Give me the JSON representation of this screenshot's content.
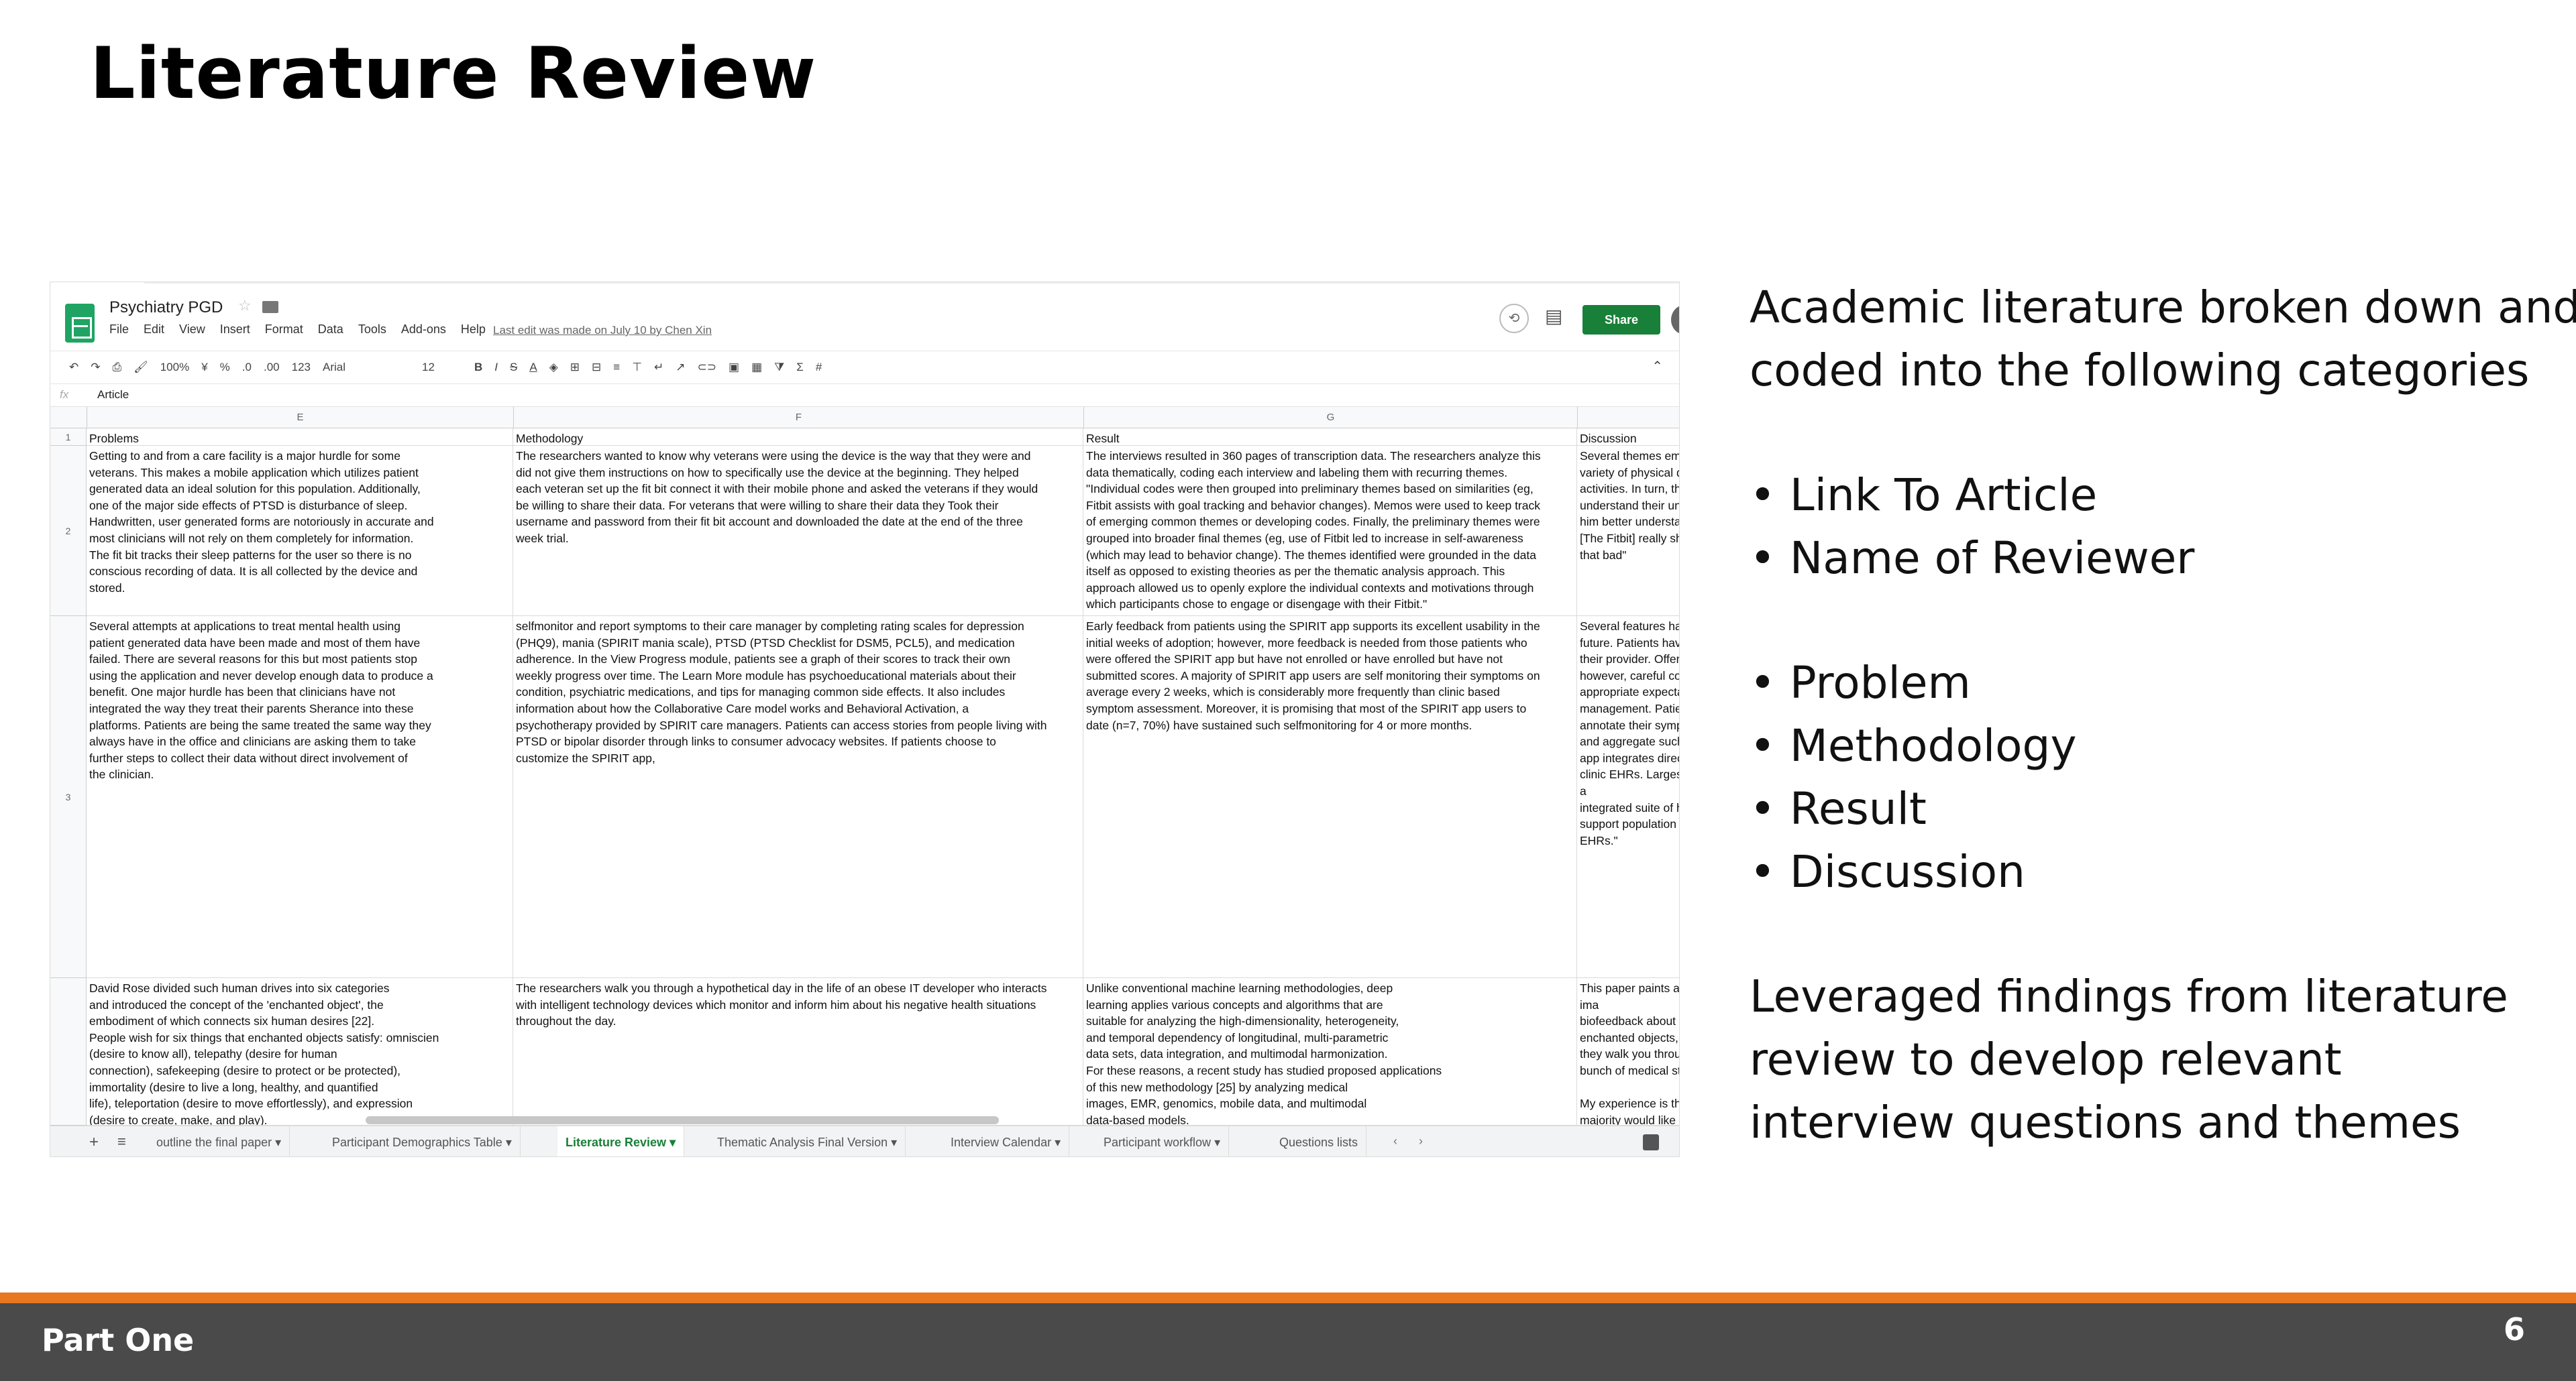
{
  "slide": {
    "title": "Literature Review",
    "footer_label": "Part One",
    "page_number": "6"
  },
  "spreadsheet": {
    "title": "Psychiatry PGD",
    "menu": [
      "File",
      "Edit",
      "View",
      "Insert",
      "Format",
      "Data",
      "Tools",
      "Add-ons",
      "Help"
    ],
    "last_edit": "Last edit was made on July 10 by Chen Xin",
    "share_label": "Share",
    "toolbar": {
      "zoom": "100%",
      "currency": "¥",
      "percent": "%",
      "dec_decrease": ".0",
      "dec_increase": ".00",
      "format": "123",
      "font": "Arial",
      "font_size": "12"
    },
    "formula_label": "fx",
    "formula_value": "Article",
    "columns": [
      "E",
      "F",
      "G",
      ""
    ],
    "rows": [
      {
        "num": "1",
        "cells": [
          "Problems",
          "Methodology",
          "Result",
          "Discussion"
        ]
      },
      {
        "num": "2",
        "cells": [
          "Getting to and from a care facility is a major hurdle for some\nveterans. This makes a mobile application which utilizes patient\ngenerated data an ideal solution for this population. Additionally,\none of the major side effects of PTSD is disturbance of sleep.\nHandwritten, user generated forms are notoriously in accurate and\nmost clinicians will not rely on them completely for information.\nThe fit bit tracks their sleep patterns for the user so there is no\nconscious recording of data. It is all collected by the device and\nstored.",
          "The researchers wanted to know why veterans were using the device is the way that they were and\ndid not give them instructions on how to specifically use the device at the beginning. They helped\neach veteran set up the fit bit connect it with their mobile phone and asked the veterans if they would\nbe willing to share their data. For veterans that were willing to share their data they Took their\nusername and password from their fit bit account and downloaded the date at the end of the three\nweek trial.",
          "The interviews resulted in 360 pages of transcription data. The researchers analyze this\ndata thematically, coding each interview and labeling them with recurring themes.\n\"Individual codes were then grouped into preliminary themes based on similarities (eg,\nFitbit assists with goal tracking and behavior changes). Memos were used to keep track\nof emerging common themes or developing codes. Finally, the preliminary themes were\ngrouped into broader final themes (eg, use of Fitbit led to increase in self-awareness\n(which may lead to behavior change). The themes identified were grounded in the data\nitself as opposed to existing theories as per the thematic analysis approach. This\napproach allowed us to openly explore the individual contexts and motivations through\nwhich participants chose to engage or disengage with their Fitbit.\"",
          "Several themes emerge\nvariety of physical data i\nactivities. In turn, this in\nunderstand their unheal\nhim better understand h\n[The Fitbit] really showe\nthat bad\""
        ]
      },
      {
        "num": "3",
        "cells": [
          "Several attempts at applications to treat mental health using\npatient generated data have been made and most of them have\nfailed. There are several reasons for this but most patients stop\nusing the application and never develop enough data to produce a\nbenefit. One major hurdle has been that clinicians have not\nintegrated the way they treat their parents Sherance into these\nplatforms. Patients are being the same treated the same way they\nalways have in the office and clinicians are asking them to take\nfurther steps to collect their data without direct involvement of\nthe clinician.",
          "selfmonitor and report symptoms to their care manager by completing rating scales for depression\n(PHQ9), mania (SPIRIT mania scale), PTSD (PTSD Checklist for DSM5, PCL5), and medication\nadherence. In the View Progress module, patients see a graph of their scores to track their own\nweekly progress over time. The Learn More module has psychoeducational materials about their\ncondition, psychiatric medications, and tips for managing common side effects. It also includes\ninformation about how the Collaborative Care model works and Behavioral Activation, a\npsychotherapy provided by SPIRIT care managers. Patients can access stories from people living with\nPTSD or bipolar disorder through links to consumer advocacy websites. If patients choose to\ncustomize the SPIRIT app,",
          "Early feedback from patients using the SPIRIT app supports its excellent usability in the\ninitial weeks of adoption; however, more feedback is needed from those patients who\nwere offered the SPIRIT app but have not enrolled or have enrolled but have not\nsubmitted scores. A majority of SPIRIT app users are self monitoring their symptoms on\naverage every 2 weeks, which is considerably more frequently than clinic based\nsymptom assessment. Moreover, it is promising that most of the SPIRIT app users to\ndate (n=7, 70%) have sustained such selfmonitoring for 4 or more months.",
          "Several features have er\nfuture. Patients have ex\ntheir provider. Offering a\nhowever, careful consid\nappropriate expectation\nmanagement. Patients h\nannotate their symptom\nand aggregate such info\napp integrates directly w\nclinic EHRs. Largescale a\nintegrated suite of healt\nsupport population hea\nEHRs.\""
        ]
      },
      {
        "num": "",
        "cells": [
          "David Rose divided such human drives into six categories\nand introduced the concept of the 'enchanted object', the\nembodiment of which connects six human desires [22].\nPeople wish for six things that enchanted objects satisfy: omniscien\n(desire to know all), telepathy (desire for human\nconnection), safekeeping (desire to protect or be protected),\nimmortality (desire to live a long, healthy, and quantified\nlife), teleportation (desire to move effortlessly), and expression\n(desire to create, make, and play).",
          "The researchers walk you through a hypothetical day in the life of an obese IT developer who interacts\nwith intelligent technology devices which monitor and inform him about his negative health situations\nthroughout the day.",
          "Unlike conventional machine learning methodologies, deep\nlearning applies various concepts and algorithms that are\nsuitable for analyzing the high-dimensionality, heterogeneity,\nand temporal dependency of longitudinal, multi-parametric\ndata sets, data integration, and multimodal harmonization.\nFor these reasons, a recent study has studied proposed applications\nof this new methodology [25] by analyzing medical\nimages, EMR, genomics, mobile data, and multimodal\ndata-based models.",
          "This paper paints an ima\nbiofeedback about us ar\nenchanted objects, peo\nthey walk you through is\nbunch of medical stuff c\n\nMy experience is that m\nmajority would like to t\nThat's why they're overv"
        ]
      }
    ],
    "tabs": [
      {
        "label": "outline the final paper",
        "active": false
      },
      {
        "label": "Participant Demographics Table",
        "active": false
      },
      {
        "label": "Literature Review",
        "active": true
      },
      {
        "label": "Thematic Analysis Final Version",
        "active": false
      },
      {
        "label": "Interview Calendar",
        "active": false
      },
      {
        "label": "Participant workflow",
        "active": false
      },
      {
        "label": "Questions lists",
        "active": false
      }
    ]
  },
  "right_panel": {
    "intro_line1": "Academic literature broken down and",
    "intro_line2": "coded into the following categories",
    "bullets_group1": [
      "Link To Article",
      "Name of Reviewer"
    ],
    "bullets_group2": [
      "Problem",
      "Methodology",
      "Result",
      "Discussion"
    ],
    "outro_line1": "Leveraged findings from literature",
    "outro_line2": "review to develop relevant",
    "outro_line3": "interview questions and themes"
  },
  "colors": {
    "footer_bar": "#4a4a4a",
    "footer_accent": "#e87722",
    "sheets_green": "#188038"
  }
}
